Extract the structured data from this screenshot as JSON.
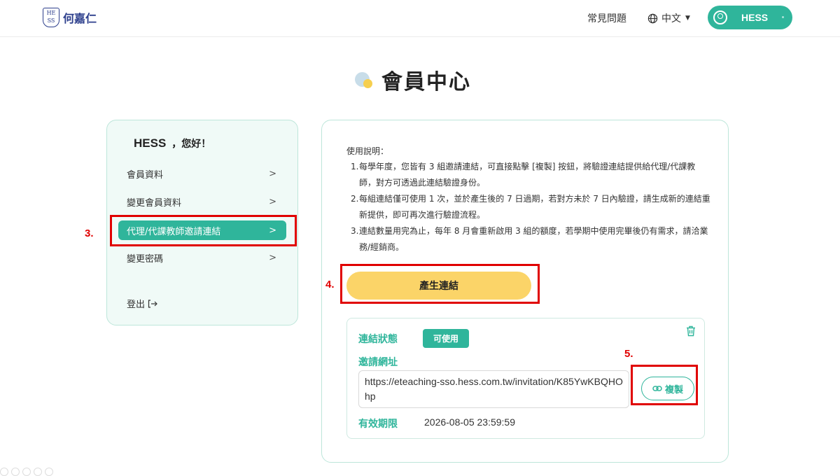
{
  "header": {
    "logo_mark": "HE SS",
    "logo_text": "何嘉仁",
    "faq": "常見問題",
    "language": "中文",
    "user_name": "HESS"
  },
  "page": {
    "title": "會員中心"
  },
  "sidebar": {
    "greeting_name": "HESS",
    "greeting_suffix": "，您好！",
    "items": [
      {
        "label": "會員資料"
      },
      {
        "label": "變更會員資料"
      },
      {
        "label": "代理/代課教師邀請連結",
        "active": true
      },
      {
        "label": "變更密碼"
      }
    ],
    "logout": "登出"
  },
  "main": {
    "instructions_title": "使用說明：",
    "instructions": [
      {
        "num": "1.",
        "text": "每學年度，您皆有 3 組邀請連結，可直接點擊 [複製] 按鈕，將驗證連結提供給代理/代課教師，對方可透過此連結驗證身份。"
      },
      {
        "num": "2.",
        "text": "每組連結僅可使用 1 次，並於產生後的 7 日過期，若對方未於 7 日內驗證，請生成新的連結重新提供，即可再次進行驗證流程。"
      },
      {
        "num": "3.",
        "text": "連結數量用完為止，每年 8 月會重新啟用 3 組的額度，若學期中使用完畢後仍有需求，請洽業務/經銷商。"
      }
    ],
    "generate_button": "產生連結",
    "link": {
      "status_label": "連結狀態",
      "status_value": "可使用",
      "url_label": "邀請網址",
      "url": "https://eteaching-sso.hess.com.tw/invitation/K85YwKBQHOhp",
      "copy_button": "複製",
      "expire_label": "有效期限",
      "expire_value": "2026-08-05 23:59:59"
    }
  },
  "annotations": [
    "3.",
    "4.",
    "5."
  ],
  "colors": {
    "accent": "#2fb59b",
    "button_yellow": "#fbd468",
    "annotation_red": "#e00000"
  }
}
